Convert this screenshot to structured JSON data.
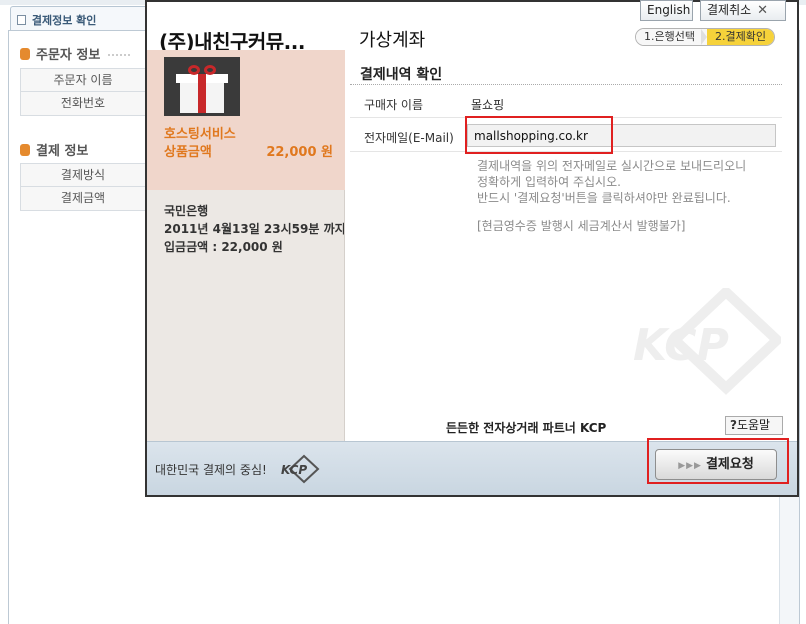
{
  "background_page": {
    "tab_title": "결제정보 확인",
    "orderer_section_title": "주문자 정보",
    "orderer_fields": [
      "주문자 이름",
      "전화번호"
    ],
    "payment_section_title": "결제 정보",
    "payment_fields": [
      "결제방식",
      "결제금액"
    ]
  },
  "popup": {
    "merchant_name": "(주)내친구커뮤...",
    "payment_method": "가상계좌",
    "english_button": "English",
    "cancel_button": "결제취소",
    "cancel_icon": "close-icon",
    "steps": [
      "1.은행선택",
      "2.결제확인"
    ],
    "active_step_index": 1,
    "product": {
      "image_icon": "gift-box-icon",
      "name": "호스팅서비스",
      "amount_label": "상품금액",
      "amount_value": "22,000 원"
    },
    "bank": {
      "bank_name": "국민은행",
      "deadline": "2011년 4월13일 23시59분 까지",
      "deposit_amount": "입금금액 : 22,000 원"
    },
    "section_title": "결제내역 확인",
    "buyer_label": "구매자 이름",
    "buyer_value": "몰쇼핑",
    "email_label": "전자메일(E-Mail)",
    "email_value": "mallshopping.co.kr",
    "notice_lines": [
      "결제내역을 위의 전자메일로 실시간으로 보내드리오니",
      "정확하게 입력하여 주십시오.",
      "반드시 '결제요청'버튼을 클릭하셔야만 완료됩니다."
    ],
    "receipt_note": "[현금영수증 발행시 세금계산서 발행불가]",
    "partner_text": "든든한 전자상거래 파트너 KCP",
    "help_button": "도움말",
    "footer_slogan": "대한민국 결제의 중심!",
    "pay_button": "결제요청",
    "accent_colors": {
      "orange": "#e0781e",
      "step_active": "#f6d23a",
      "highlight_red": "#e02020"
    }
  }
}
